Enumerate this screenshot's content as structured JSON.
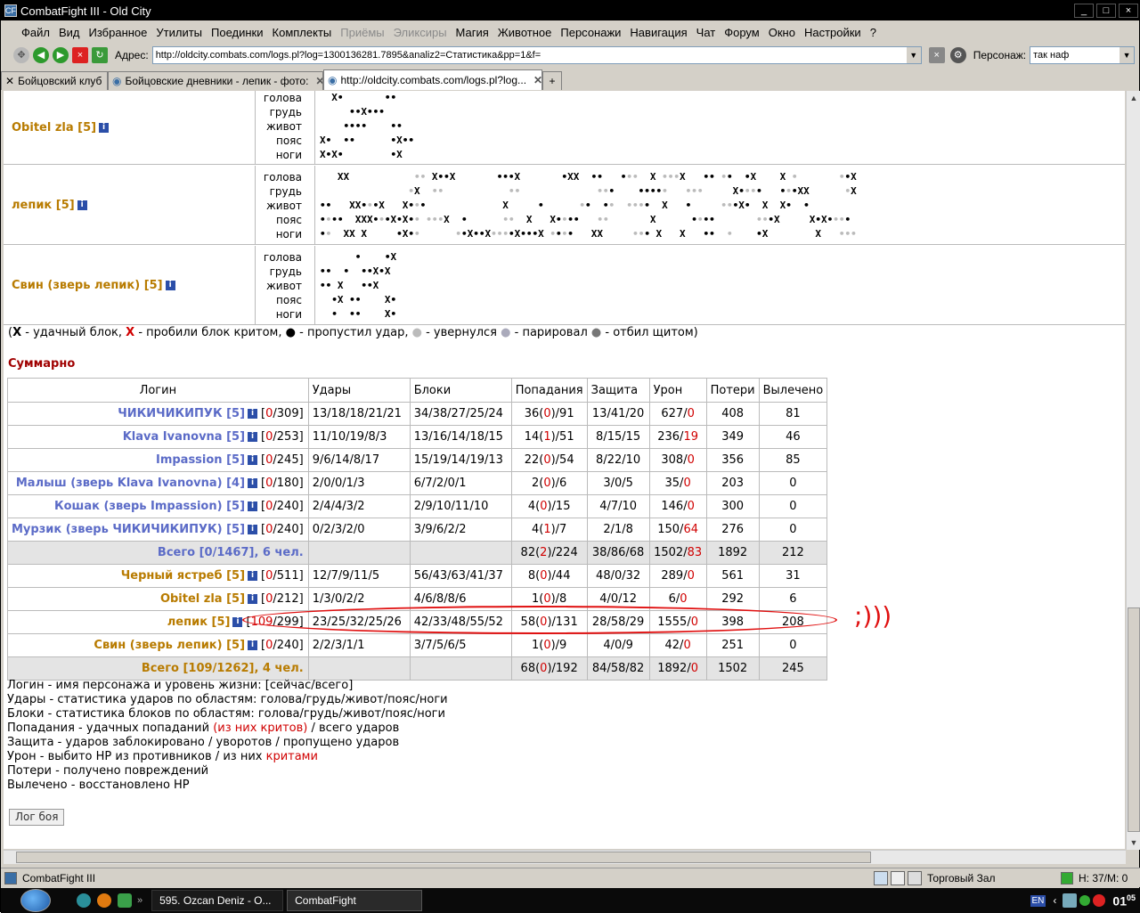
{
  "window": {
    "title": "CombatFight III - Old City"
  },
  "menu": [
    "Файл",
    "Вид",
    "Избранное",
    "Утилиты",
    "Поединки",
    "Комплекты",
    "Приёмы",
    "Эликсиры",
    "Магия",
    "Животное",
    "Персонажи",
    "Навигация",
    "Чат",
    "Форум",
    "Окно",
    "Настройки",
    "?"
  ],
  "menu_disabled": [
    "Приёмы",
    "Эликсиры"
  ],
  "addrbar": {
    "label": "Адрес:",
    "url": "http://oldcity.combats.com/logs.pl?log=1300136281.7895&analiz2=Статистика&pp=1&f=",
    "char_label": "Персонаж:",
    "char_value": "так наф"
  },
  "tabs": [
    {
      "label": "Бойцовский клуб"
    },
    {
      "label": "Бойцовские дневники - лепик - фото:"
    },
    {
      "label": "http://oldcity.combats.com/logs.pl?log..."
    }
  ],
  "zones": [
    "голова",
    "грудь",
    "живот",
    "пояс",
    "ноги"
  ],
  "fighters": [
    {
      "name": "Obitel zla [5]",
      "rows": [
        "  X•       ••",
        "     ••X•••",
        "    ••••    ••",
        "X•  ••      •X••",
        "X•X•        •X"
      ]
    },
    {
      "name": "лепик [5]",
      "rows": [
        "   XX           ◦◦ X••X       •••X       •XX  ••   •◦◦  X ◦◦◦X   •• ◦•  •X    X ◦       ◦•X",
        "               ◦X  ◦◦           ◦◦             ◦◦•    ••••◦   ◦◦◦     X•◦◦•   •◦•XX      ◦X",
        "••   XX•◦•X   X•◦•             X     •      ◦•  •◦  ◦◦◦•  X   •     ◦◦•X•  X  X•  •",
        "•◦••  XXX•◦•X•X•◦ ◦◦◦X  •      ◦◦  X   X•◦••   ◦◦       X      •◦••       ◦◦•X     X•X•◦◦•",
        "•◦  XX X     •X•◦      ◦•X••X◦◦◦•X•••X ◦•◦•   XX     ◦◦• X   X   ••  ◦    •X        X   ◦◦◦"
      ]
    },
    {
      "name": "Свин (зверь лепик) [5]",
      "rows": [
        "      •    •X",
        "••  •  ••X•X",
        "•• X   ••X",
        "  •X ••    X•",
        "  •  ••    X•"
      ]
    }
  ],
  "legend": {
    "x_block": "X",
    "x_block_text": " - удачный блок,",
    "x_crit": "X",
    "x_crit_text": " - пробили блок критом,",
    "dot_text": " - пропустил удар,",
    "grey_text": " - увернулся",
    "blue_text": " - парировал",
    "dark_text": " - отбил щитом)"
  },
  "summary": {
    "title": "Суммарно",
    "headers": [
      "Логин",
      "Удары",
      "Блоки",
      "Попадания",
      "Защита",
      "Урон",
      "Потери",
      "Вылечено"
    ],
    "rows": [
      {
        "login": "ЧИКИЧИКИПУК [5]",
        "hp_now": "0",
        "hp_total": "309",
        "team": "blue",
        "hits": "13/18/18/21/21",
        "blocks": "34/38/27/25/24",
        "hit_ok": "36",
        "hit_crit": "0",
        "hit_all": "91",
        "def": "13/41/20",
        "dmg": "627",
        "dmg_crit": "0",
        "loss": "408",
        "heal": "81"
      },
      {
        "login": "Klava Ivanovna [5]",
        "hp_now": "0",
        "hp_total": "253",
        "team": "blue",
        "hits": "11/10/19/8/3",
        "blocks": "13/16/14/18/15",
        "hit_ok": "14",
        "hit_crit": "1",
        "hit_all": "51",
        "def": "8/15/15",
        "dmg": "236",
        "dmg_crit": "19",
        "loss": "349",
        "heal": "46"
      },
      {
        "login": "Impassion [5]",
        "hp_now": "0",
        "hp_total": "245",
        "team": "blue",
        "hits": "9/6/14/8/17",
        "blocks": "15/19/14/19/13",
        "hit_ok": "22",
        "hit_crit": "0",
        "hit_all": "54",
        "def": "8/22/10",
        "dmg": "308",
        "dmg_crit": "0",
        "loss": "356",
        "heal": "85"
      },
      {
        "login": "Малыш (зверь Klava Ivanovna) [4]",
        "hp_now": "0",
        "hp_total": "180",
        "team": "blue",
        "hits": "2/0/0/1/3",
        "blocks": "6/7/2/0/1",
        "hit_ok": "2",
        "hit_crit": "0",
        "hit_all": "6",
        "def": "3/0/5",
        "dmg": "35",
        "dmg_crit": "0",
        "loss": "203",
        "heal": "0"
      },
      {
        "login": "Кошак (зверь Impassion) [5]",
        "hp_now": "0",
        "hp_total": "240",
        "team": "blue",
        "hits": "2/4/4/3/2",
        "blocks": "2/9/10/11/10",
        "hit_ok": "4",
        "hit_crit": "0",
        "hit_all": "15",
        "def": "4/7/10",
        "dmg": "146",
        "dmg_crit": "0",
        "loss": "300",
        "heal": "0"
      },
      {
        "login": "Мурзик (зверь ЧИКИЧИКИПУК) [5]",
        "hp_now": "0",
        "hp_total": "240",
        "team": "blue",
        "hits": "0/2/3/2/0",
        "blocks": "3/9/6/2/2",
        "hit_ok": "4",
        "hit_crit": "1",
        "hit_all": "7",
        "def": "2/1/8",
        "dmg": "150",
        "dmg_crit": "64",
        "loss": "276",
        "heal": "0"
      },
      {
        "total": true,
        "login": "Всего [0/1467], 6 чел.",
        "team": "blue",
        "hits": "",
        "blocks": "",
        "hit_ok": "82",
        "hit_crit": "2",
        "hit_all": "224",
        "def": "38/86/68",
        "dmg": "1502",
        "dmg_crit": "83",
        "loss": "1892",
        "heal": "212"
      },
      {
        "login": "Черный ястреб [5]",
        "hp_now": "0",
        "hp_total": "511",
        "team": "orange",
        "hits": "12/7/9/11/5",
        "blocks": "56/43/63/41/37",
        "hit_ok": "8",
        "hit_crit": "0",
        "hit_all": "44",
        "def": "48/0/32",
        "dmg": "289",
        "dmg_crit": "0",
        "loss": "561",
        "heal": "31"
      },
      {
        "login": "Obitel zla [5]",
        "hp_now": "0",
        "hp_total": "212",
        "team": "orange",
        "hits": "1/3/0/2/2",
        "blocks": "4/6/8/8/6",
        "hit_ok": "1",
        "hit_crit": "0",
        "hit_all": "8",
        "def": "4/0/12",
        "dmg": "6",
        "dmg_crit": "0",
        "loss": "292",
        "heal": "6"
      },
      {
        "login": "лепик [5]",
        "hp_now": "109",
        "hp_total": "299",
        "team": "orange",
        "hits": "23/25/32/25/26",
        "blocks": "42/33/48/55/52",
        "hit_ok": "58",
        "hit_crit": "0",
        "hit_all": "131",
        "def": "28/58/29",
        "dmg": "1555",
        "dmg_crit": "0",
        "loss": "398",
        "heal": "208"
      },
      {
        "login": "Свин (зверь лепик) [5]",
        "hp_now": "0",
        "hp_total": "240",
        "team": "orange",
        "hits": "2/2/3/1/1",
        "blocks": "3/7/5/6/5",
        "hit_ok": "1",
        "hit_crit": "0",
        "hit_all": "9",
        "def": "4/0/9",
        "dmg": "42",
        "dmg_crit": "0",
        "loss": "251",
        "heal": "0"
      },
      {
        "total": true,
        "login": "Всего [109/1262], 4 чел.",
        "team": "orange",
        "hits": "",
        "blocks": "",
        "hit_ok": "68",
        "hit_crit": "0",
        "hit_all": "192",
        "def": "84/58/82",
        "dmg": "1892",
        "dmg_crit": "0",
        "loss": "1502",
        "heal": "245"
      }
    ]
  },
  "annotation": ";)))",
  "notes": [
    {
      "text": "Логин - имя персонажа и уровень жизни: [сейчас/всего]"
    },
    {
      "text": "Удары - статистика ударов по областям: голова/грудь/живот/пояс/ноги"
    },
    {
      "text": "Блоки - статистика блоков по областям: голова/грудь/живот/пояс/ноги"
    },
    {
      "text": "Попадания - удачных попаданий ",
      "red": "(из них критов)",
      "tail": " / всего ударов"
    },
    {
      "text": "Защита - ударов заблокировано / уворотов / пропущено ударов"
    },
    {
      "text": "Урон - выбито HP из противников / из них ",
      "red": "критами"
    },
    {
      "text": "Потери - получено повреждений"
    },
    {
      "text": "Вылечено - восстановлено HP"
    }
  ],
  "log_button": "Лог боя",
  "status": {
    "app": "CombatFight III",
    "room": "Торговый Зал",
    "hp": "H: 37/M: 0"
  },
  "taskbar": {
    "items": [
      "595. Ozcan Deniz - O...",
      "CombatFight"
    ],
    "lang": "EN",
    "clock_h": "01",
    "clock_m": "05"
  },
  "colors": {
    "team1": "#5b6bc7",
    "team2": "#b87b00",
    "crit": "#d00000",
    "annotation": "#e01010"
  }
}
